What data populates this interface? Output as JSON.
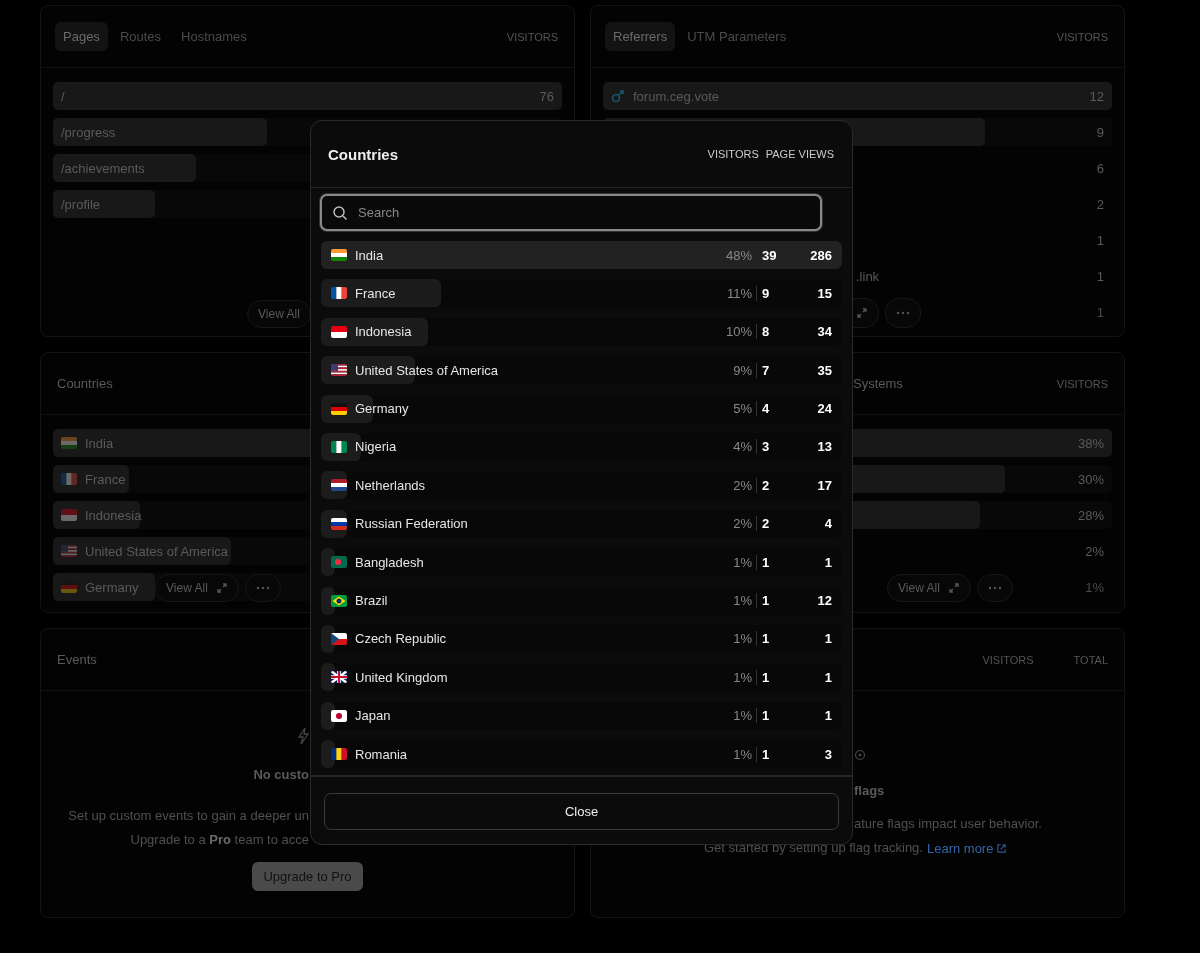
{
  "pages_panel": {
    "tabs": [
      {
        "label": "Pages",
        "selected": true
      },
      {
        "label": "Routes",
        "selected": false
      },
      {
        "label": "Hostnames",
        "selected": false
      }
    ],
    "column": "VISITORS",
    "rows": [
      {
        "label": "/",
        "value": "76",
        "level": 1
      },
      {
        "label": "/progress",
        "level": 0.42
      },
      {
        "label": "/achievements",
        "level": 0.28
      },
      {
        "label": "/profile",
        "level": 0.2
      }
    ],
    "view_all": "View All"
  },
  "referrers_panel": {
    "tabs": [
      {
        "label": "Referrers",
        "selected": true
      },
      {
        "label": "UTM Parameters",
        "selected": false
      }
    ],
    "column": "VISITORS",
    "rows": [
      {
        "label": "forum.ceg.vote",
        "value": "12",
        "level": 1
      },
      {
        "value": "9",
        "level": 0.75
      },
      {
        "value": "6"
      },
      {
        "value": "2"
      },
      {
        "value": "1"
      },
      {
        "label": ".link",
        "value": "1"
      },
      {
        "value": "1"
      }
    ]
  },
  "countries_panel": {
    "title": "Countries",
    "rows": [
      {
        "kind": "in",
        "name": "India",
        "level": 1
      },
      {
        "kind": "fr",
        "name": "France",
        "level": 0.15
      },
      {
        "kind": "id",
        "name": "Indonesia",
        "level": 0.17
      },
      {
        "kind": "us",
        "name": "United States of America",
        "level": 0.35
      },
      {
        "kind": "de",
        "name": "Germany",
        "level": 0.2
      }
    ],
    "view_all": "View All"
  },
  "systems_panel": {
    "title": "Systems",
    "column": "VISITORS",
    "rows": [
      {
        "value": "38%",
        "level": 1
      },
      {
        "value": "30%",
        "level": 0.79
      },
      {
        "value": "28%",
        "level": 0.74
      },
      {
        "value": "2%"
      },
      {
        "value": "1%"
      }
    ],
    "view_all": "View All"
  },
  "events_panel": {
    "title": "Events",
    "heading": "No custo",
    "lines": [
      "Set up custom events to gain a deeper un",
      "Upgrade to a **Pro** team to acce"
    ],
    "button": "Upgrade to Pro"
  },
  "flags_panel": {
    "columns": [
      "VISITORS",
      "TOTAL"
    ],
    "heading": "flags",
    "lines": [
      "ature flags impact user behavior."
    ],
    "started": "Get started by setting up flag tracking.",
    "link": "Learn more"
  },
  "modal": {
    "title": "Countries",
    "columns": [
      "VISITORS",
      "PAGE VIEWS"
    ],
    "search": {
      "placeholder": "Search"
    },
    "rows": [
      {
        "kind": "in",
        "name": "India",
        "share": "48%",
        "visitors": "39",
        "page_views": "286",
        "level": 1,
        "selected": true
      },
      {
        "kind": "fr",
        "name": "France",
        "share": "11%",
        "visitors": "9",
        "page_views": "15",
        "level": 0.23,
        "selected": false
      },
      {
        "kind": "id",
        "name": "Indonesia",
        "share": "10%",
        "visitors": "8",
        "page_views": "34",
        "level": 0.205,
        "selected": false
      },
      {
        "kind": "us",
        "name": "United States of America",
        "share": "9%",
        "visitors": "7",
        "page_views": "35",
        "level": 0.18,
        "selected": false
      },
      {
        "kind": "de",
        "name": "Germany",
        "share": "5%",
        "visitors": "4",
        "page_views": "24",
        "level": 0.1,
        "selected": false
      },
      {
        "kind": "ng",
        "name": "Nigeria",
        "share": "4%",
        "visitors": "3",
        "page_views": "13",
        "level": 0.077,
        "selected": false
      },
      {
        "kind": "nl",
        "name": "Netherlands",
        "share": "2%",
        "visitors": "2",
        "page_views": "17",
        "level": 0.05,
        "selected": false
      },
      {
        "kind": "ru",
        "name": "Russian Federation",
        "share": "2%",
        "visitors": "2",
        "page_views": "4",
        "level": 0.05,
        "selected": false
      },
      {
        "kind": "bd",
        "name": "Bangladesh",
        "share": "1%",
        "visitors": "1",
        "page_views": "1",
        "level": 0.026,
        "selected": false
      },
      {
        "kind": "br",
        "name": "Brazil",
        "share": "1%",
        "visitors": "1",
        "page_views": "12",
        "level": 0.026,
        "selected": false
      },
      {
        "kind": "cz",
        "name": "Czech Republic",
        "share": "1%",
        "visitors": "1",
        "page_views": "1",
        "level": 0.026,
        "selected": false
      },
      {
        "kind": "gb",
        "name": "United Kingdom",
        "share": "1%",
        "visitors": "1",
        "page_views": "1",
        "level": 0.026,
        "selected": false
      },
      {
        "kind": "jp",
        "name": "Japan",
        "share": "1%",
        "visitors": "1",
        "page_views": "1",
        "level": 0.026,
        "selected": false
      },
      {
        "kind": "ro",
        "name": "Romania",
        "share": "1%",
        "visitors": "1",
        "page_views": "3",
        "level": 0.026,
        "selected": false
      }
    ],
    "close": "Close"
  }
}
